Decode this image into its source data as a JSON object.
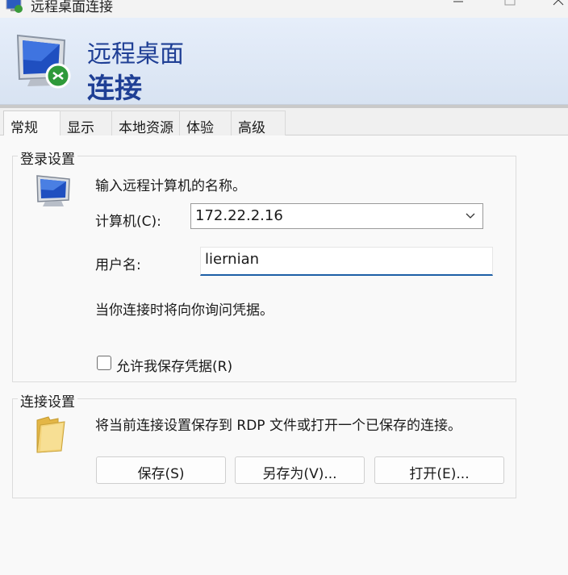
{
  "window": {
    "title": "远程桌面连接"
  },
  "header": {
    "line1": "远程桌面",
    "line2": "连接"
  },
  "tabs": [
    {
      "label": "常规",
      "active": true
    },
    {
      "label": "显示",
      "active": false
    },
    {
      "label": "本地资源",
      "active": false
    },
    {
      "label": "体验",
      "active": false
    },
    {
      "label": "高级",
      "active": false
    }
  ],
  "login_settings": {
    "title": "登录设置",
    "prompt": "输入远程计算机的名称。",
    "computer_label": "计算机(C):",
    "computer_value": "172.22.2.16",
    "username_label": "用户名:",
    "username_value": "liernian",
    "credentials_note": "当你连接时将向你询问凭据。",
    "save_credentials_label": "允许我保存凭据(R)",
    "save_credentials_checked": false
  },
  "connection_settings": {
    "title": "连接设置",
    "description": "将当前连接设置保存到 RDP 文件或打开一个已保存的连接。",
    "save_button": "保存(S)",
    "save_as_button": "另存为(V)...",
    "open_button": "打开(E)..."
  }
}
